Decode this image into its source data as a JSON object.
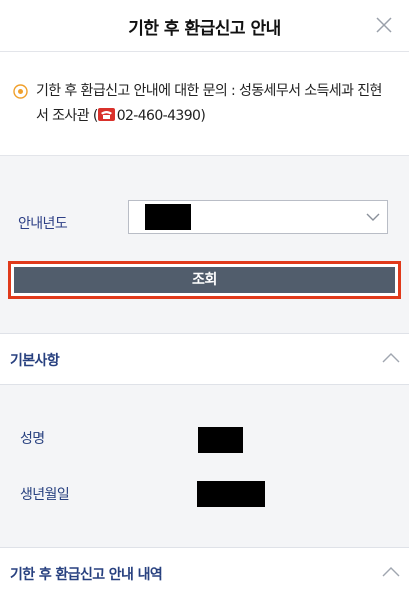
{
  "header": {
    "title": "기한 후 환급신고 안내"
  },
  "notice": {
    "text": "기한 후 환급신고 안내에 대한 문의 : 성동세무서 소득세과 진현서 조사관 (",
    "phone": "02-460-4390)"
  },
  "year": {
    "label": "안내년도"
  },
  "query": {
    "label": "조회"
  },
  "basic": {
    "title": "기본사항",
    "rows": [
      {
        "label": "성명"
      },
      {
        "label": "생년월일"
      }
    ]
  },
  "history": {
    "title": "기한 후 환급신고 안내 내역"
  },
  "colors": {
    "accent_border": "#e03a1b",
    "button_bg": "#515d6c",
    "label_blue": "#27407f"
  }
}
